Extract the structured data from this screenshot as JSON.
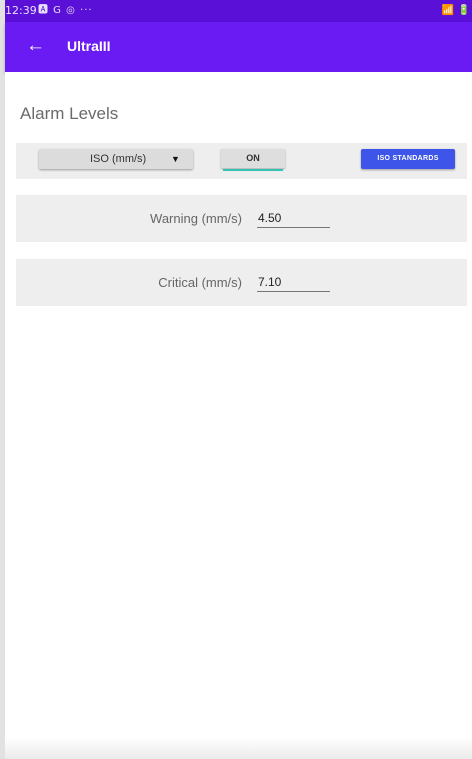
{
  "status_bar": {
    "time": "12:39",
    "icons": "🅰 G ◎ ···",
    "right": "📶 🔋"
  },
  "app_bar": {
    "back_icon": "←",
    "title": "UltraIII"
  },
  "alarm_levels": {
    "title": "Alarm Levels",
    "unit_select": {
      "value": "ISO (mm/s)",
      "caret": "▼"
    },
    "toggle_label": "ON",
    "iso_button_label": "ISO STANDARDS",
    "warning": {
      "label": "Warning (mm/s)",
      "value": "4.50"
    },
    "critical": {
      "label": "Critical (mm/s)",
      "value": "7.10"
    }
  },
  "colors": {
    "status_bar": "#5a10d6",
    "app_bar": "#6a1bf3",
    "iso_button": "#3d55e8",
    "toggle_accent": "#35c4b3"
  }
}
